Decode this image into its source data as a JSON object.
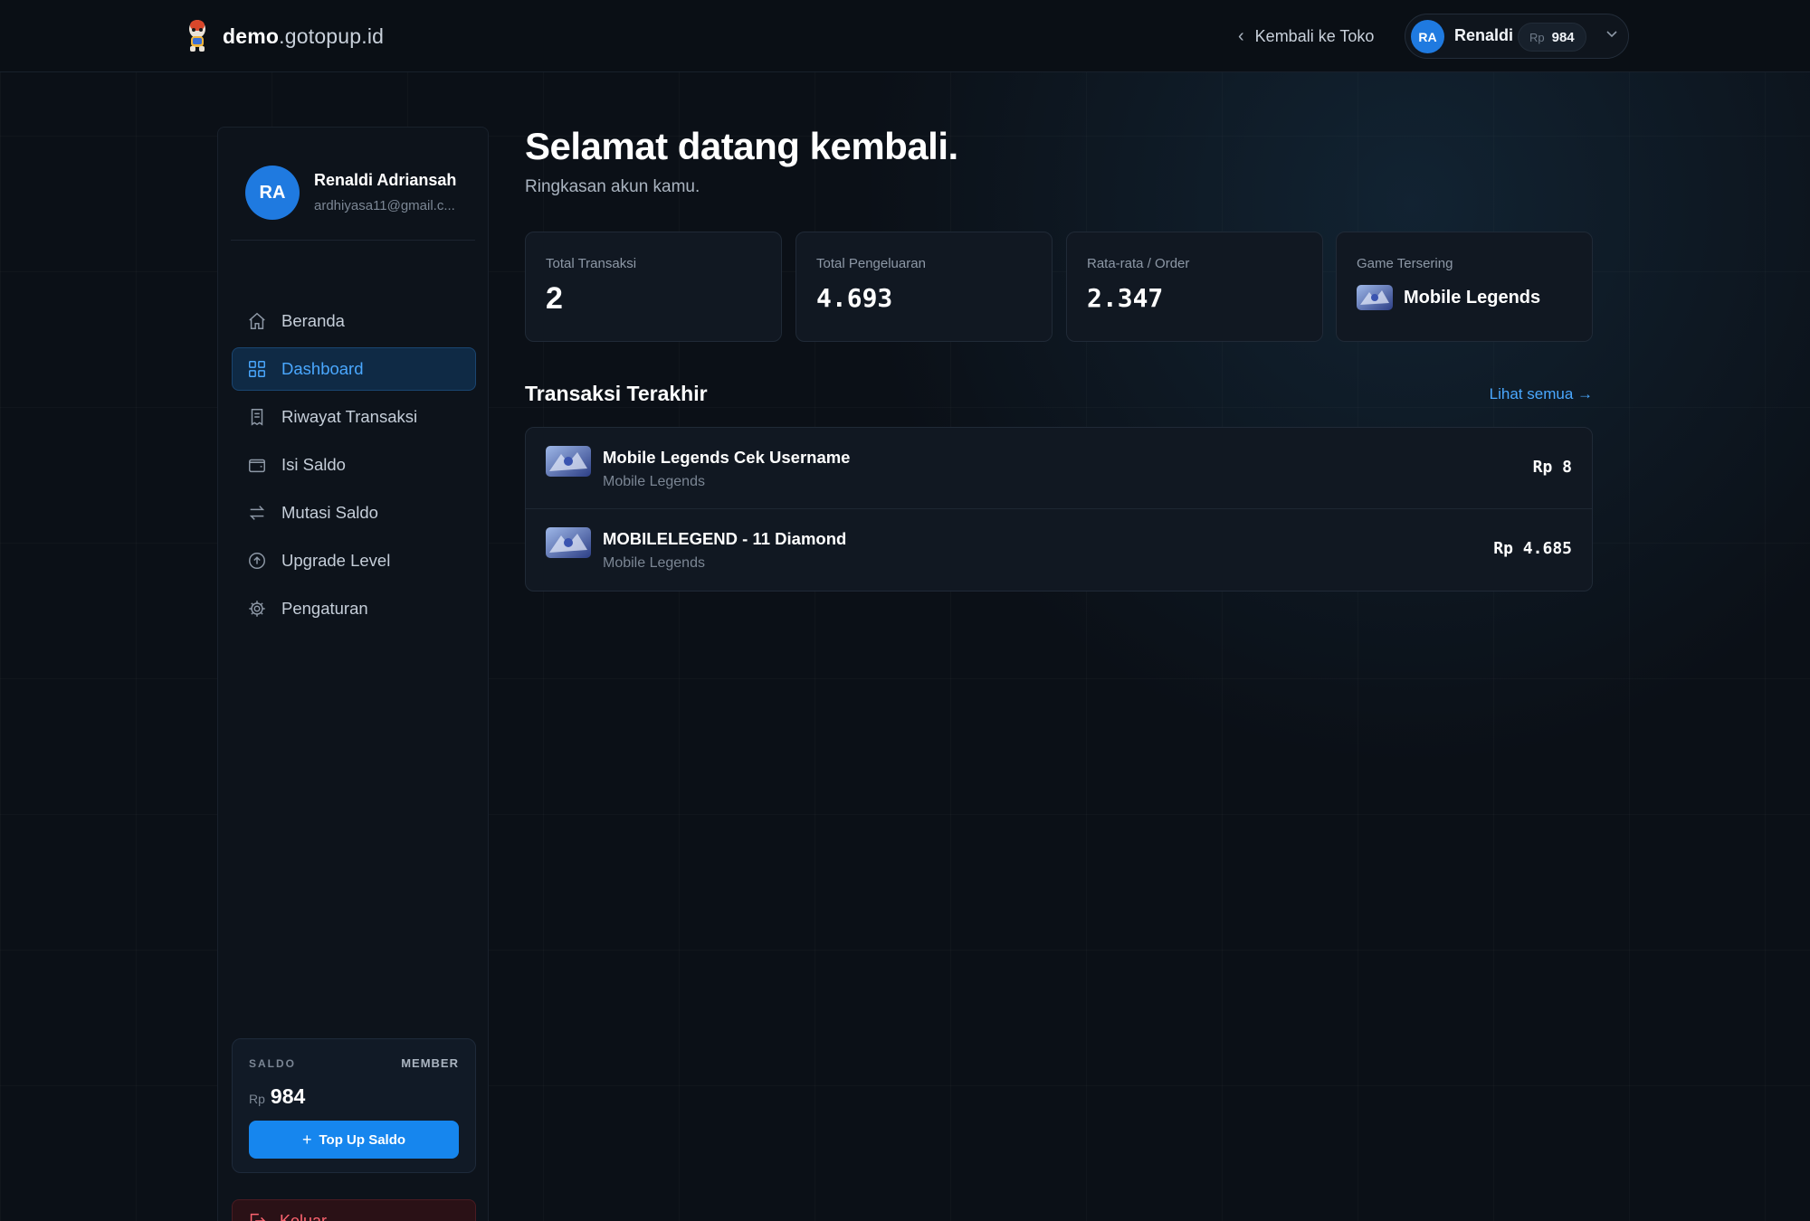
{
  "header": {
    "brand_bold": "demo",
    "brand_rest": ".gotopup.id",
    "back_label": "Kembali ke Toko",
    "user_initials": "RA",
    "user_name": "Renaldi",
    "balance_currency": "Rp",
    "balance_amount": "984"
  },
  "sidebar": {
    "profile": {
      "initials": "RA",
      "name": "Renaldi Adriansah",
      "email": "ardhiyasa11@gmail.c..."
    },
    "items": [
      {
        "label": "Beranda",
        "icon": "home-icon"
      },
      {
        "label": "Dashboard",
        "icon": "grid-icon",
        "active": true
      },
      {
        "label": "Riwayat Transaksi",
        "icon": "receipt-icon"
      },
      {
        "label": "Isi Saldo",
        "icon": "wallet-icon"
      },
      {
        "label": "Mutasi Saldo",
        "icon": "transfer-icon"
      },
      {
        "label": "Upgrade Level",
        "icon": "arrow-up-circle-icon"
      },
      {
        "label": "Pengaturan",
        "icon": "gear-icon"
      }
    ],
    "saldo": {
      "label": "SALDO",
      "level": "MEMBER",
      "currency": "Rp",
      "amount": "984",
      "topup_label": "Top Up Saldo"
    },
    "logout_label": "Keluar"
  },
  "main": {
    "title": "Selamat datang kembali.",
    "subtitle": "Ringkasan akun kamu.",
    "stats": [
      {
        "label": "Total Transaksi",
        "value": "2"
      },
      {
        "label": "Total Pengeluaran",
        "value": "4.693"
      },
      {
        "label": "Rata-rata / Order",
        "value": "2.347"
      },
      {
        "label": "Game Tersering",
        "value": "Mobile Legends"
      }
    ],
    "recent_title": "Transaksi Terakhir",
    "see_all_label": "Lihat semua →",
    "transactions": [
      {
        "name": "Mobile Legends Cek Username",
        "game": "Mobile Legends",
        "amount": "Rp 8"
      },
      {
        "name": "MOBILELEGEND - 11 Diamond",
        "game": "Mobile Legends",
        "amount": "Rp 4.685"
      }
    ]
  },
  "colors": {
    "accent": "#1686ee",
    "accent_text": "#4aa8ff",
    "background": "#0b1017",
    "danger": "#ff6470"
  }
}
